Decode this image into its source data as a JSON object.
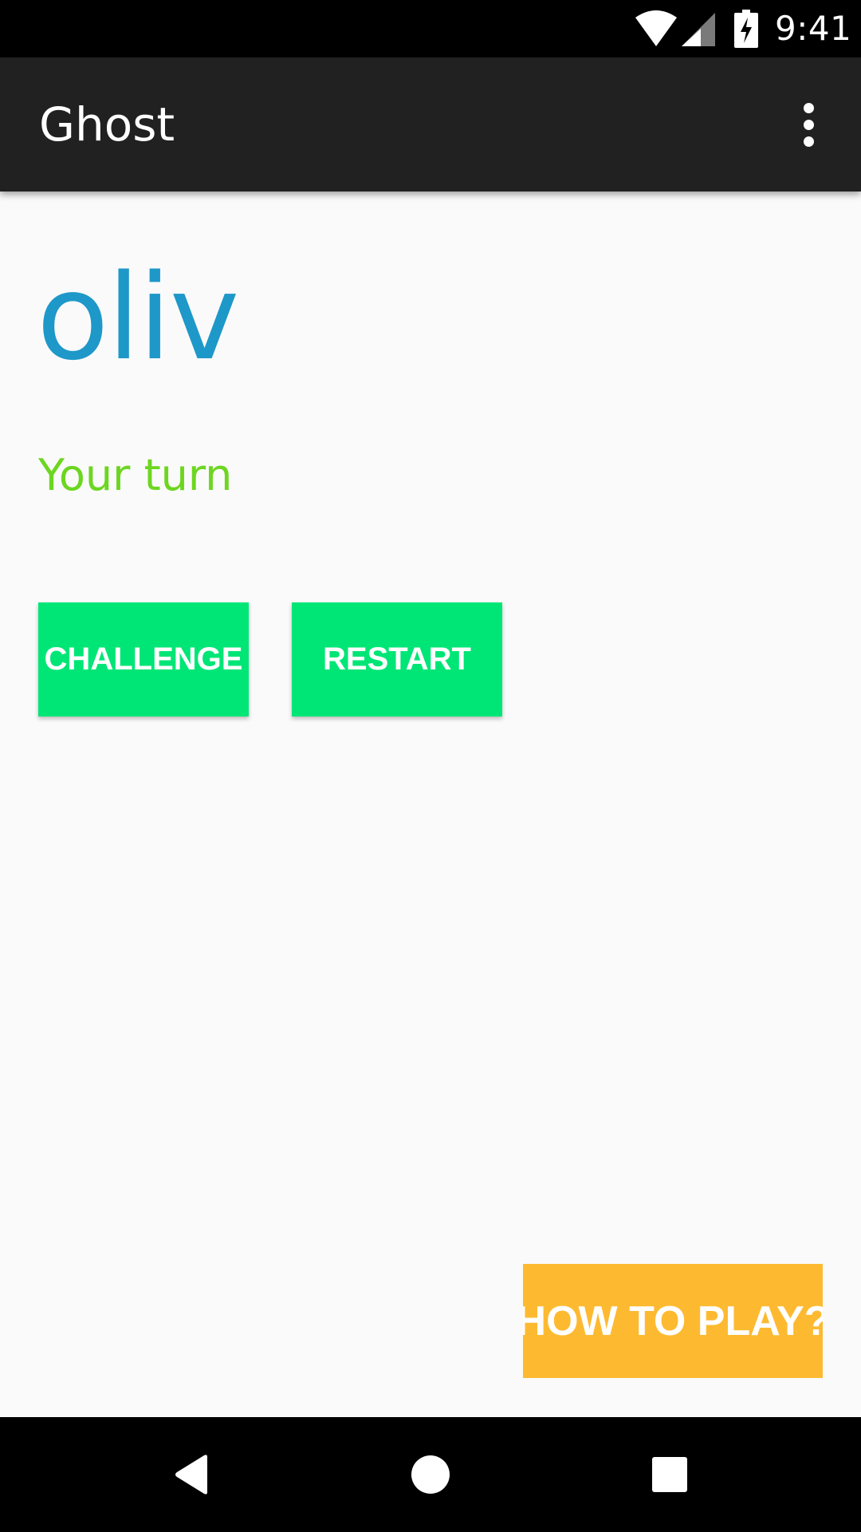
{
  "status_bar": {
    "time": "9:41",
    "icons": [
      "wifi-icon",
      "cell-signal-icon",
      "battery-charging-icon"
    ]
  },
  "app_bar": {
    "title": "Ghost",
    "overflow_icon": "more-vert-icon"
  },
  "game": {
    "word": "oliv",
    "status": "Your turn",
    "word_color": "#1e98c8",
    "status_color": "#6cd620"
  },
  "actions": {
    "challenge_label": "CHALLENGE",
    "restart_label": "RESTART",
    "how_to_play_label": "HOW TO PLAY?",
    "primary_color": "#00e676",
    "help_color": "#fdba31"
  },
  "nav_bar": {
    "icons": [
      "back-icon",
      "home-icon",
      "recents-icon"
    ]
  }
}
